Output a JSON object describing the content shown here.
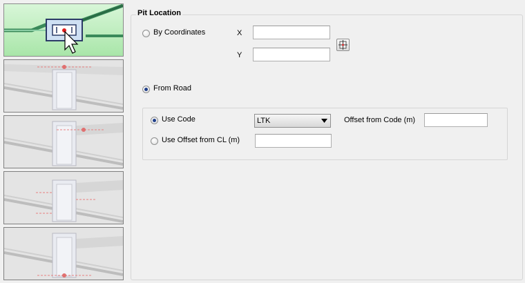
{
  "thumbnails": {
    "items": [
      {
        "name": "plan-view",
        "selected": true
      },
      {
        "name": "section-top",
        "selected": false
      },
      {
        "name": "section-code",
        "selected": false
      },
      {
        "name": "section-offset",
        "selected": false
      },
      {
        "name": "section-bottom",
        "selected": false
      }
    ]
  },
  "pit_location": {
    "title": "Pit Location",
    "by_coordinates": {
      "label": "By Coordinates",
      "checked": false
    },
    "x_label": "X",
    "y_label": "Y",
    "x_value": "",
    "y_value": "",
    "pick_icon": "pick-point-icon",
    "from_road": {
      "label": "From Road",
      "checked": true
    },
    "use_code": {
      "label": "Use Code",
      "checked": true
    },
    "code_value": "LTK",
    "offset_from_code_label": "Offset from Code (m)",
    "offset_from_code_value": "",
    "use_offset_cl": {
      "label": "Use Offset from CL (m)",
      "checked": false
    },
    "offset_cl_value": ""
  },
  "colors": {
    "accent_green": "#a9e6a9",
    "radio_dot": "#1f3f8a"
  }
}
